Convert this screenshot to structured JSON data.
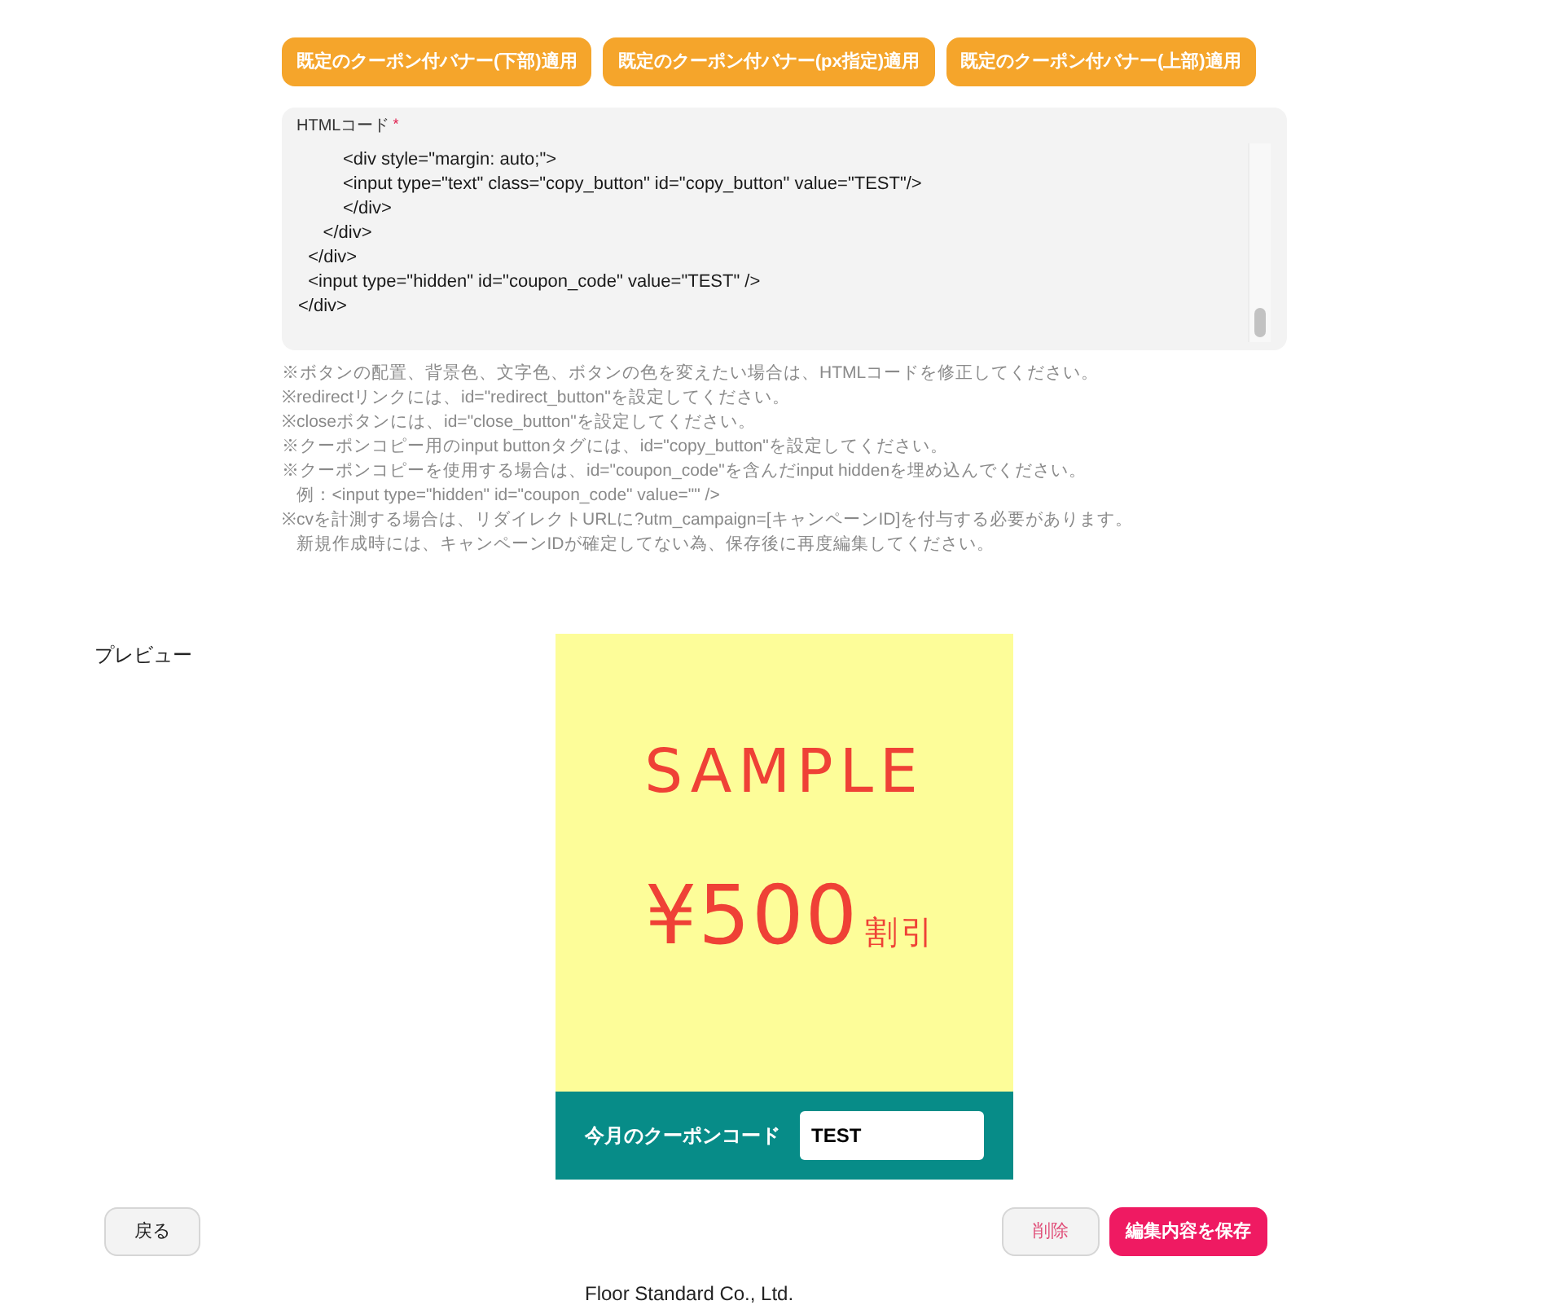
{
  "template_buttons": [
    "既定のクーポン付バナー(下部)適用",
    "既定のクーポン付バナー(px指定)適用",
    "既定のクーポン付バナー(上部)適用"
  ],
  "html_code": {
    "label": "HTMLコード",
    "required_mark": "*",
    "lines": [
      "         <div style=\"margin: auto;\">",
      "         <input type=\"text\" class=\"copy_button\" id=\"copy_button\" value=\"TEST\"/>",
      "         </div>",
      "     </div>",
      "  </div>",
      "  <input type=\"hidden\" id=\"coupon_code\" value=\"TEST\" />",
      "</div>"
    ]
  },
  "notes": [
    "※ボタンの配置、背景色、文字色、ボタンの色を変えたい場合は、HTMLコードを修正してください。",
    "※redirectリンクには、id=\"redirect_button\"を設定してください。",
    "※closeボタンには、id=\"close_button\"を設定してください。",
    "※クーポンコピー用のinput buttonタグには、id=\"copy_button\"を設定してください。",
    "※クーポンコピーを使用する場合は、id=\"coupon_code\"を含んだinput hiddenを埋め込んでください。",
    "   例：<input type=\"hidden\" id=\"coupon_code\" value=\"\" />",
    "※cvを計測する場合は、リダイレクトURLに?utm_campaign=[キャンペーンID]を付与する必要があります。",
    "   新規作成時には、キャンペーンIDが確定してない為、保存後に再度編集してください。"
  ],
  "preview": {
    "label": "プレビュー",
    "banner": {
      "title": "SAMPLE",
      "amount": "¥500",
      "amount_suffix": "割引",
      "coupon_label": "今月のクーポンコード",
      "coupon_code": "TEST"
    }
  },
  "actions": {
    "back": "戻る",
    "delete": "削除",
    "save": "編集内容を保存"
  },
  "footer": "Floor Standard Co., Ltd."
}
